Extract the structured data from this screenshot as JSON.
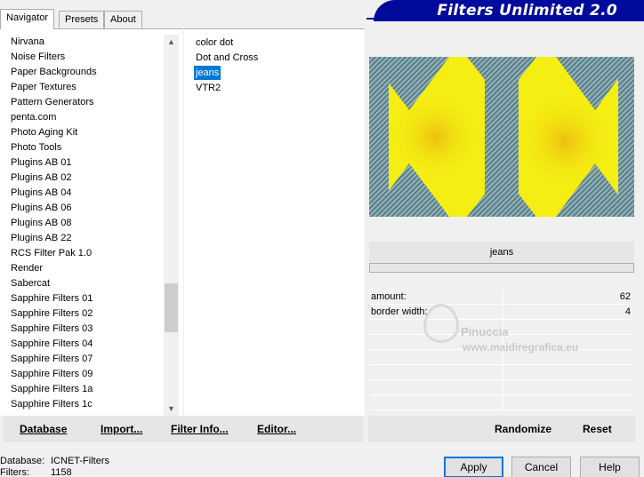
{
  "tabs": [
    {
      "label": "Navigator",
      "active": true
    },
    {
      "label": "Presets",
      "active": false
    },
    {
      "label": "About",
      "active": false
    }
  ],
  "banner": {
    "title": "Filters Unlimited 2.0"
  },
  "categories": [
    "Nirvana",
    "Noise Filters",
    "Paper Backgrounds",
    "Paper Textures",
    "Pattern Generators",
    "penta.com",
    "Photo Aging Kit",
    "Photo Tools",
    "Plugins AB 01",
    "Plugins AB 02",
    "Plugins AB 04",
    "Plugins AB 06",
    "Plugins AB 08",
    "Plugins AB 22",
    "RCS Filter Pak 1.0",
    "Render",
    "Sabercat",
    "Sapphire Filters 01",
    "Sapphire Filters 02",
    "Sapphire Filters 03",
    "Sapphire Filters 04",
    "Sapphire Filters 07",
    "Sapphire Filters 09",
    "Sapphire Filters 1a",
    "Sapphire Filters 1c"
  ],
  "filters": [
    {
      "label": "color dot",
      "selected": false
    },
    {
      "label": "Dot and Cross",
      "selected": false
    },
    {
      "label": "jeans",
      "selected": true
    },
    {
      "label": "VTR2",
      "selected": false
    }
  ],
  "preview": {
    "filter_name": "jeans"
  },
  "params": [
    {
      "label": "amount:",
      "value": "62"
    },
    {
      "label": "border width:",
      "value": "4"
    },
    {
      "label": "",
      "value": ""
    },
    {
      "label": "",
      "value": ""
    },
    {
      "label": "",
      "value": ""
    },
    {
      "label": "",
      "value": ""
    },
    {
      "label": "",
      "value": ""
    },
    {
      "label": "",
      "value": ""
    }
  ],
  "watermark": {
    "line1": "Pinuccia",
    "line2": "www.maidiregrafica.eu"
  },
  "left_buttons": {
    "database": "Database",
    "import": "Import...",
    "filter_info": "Filter Info...",
    "editor": "Editor..."
  },
  "right_buttons": {
    "randomize": "Randomize",
    "reset": "Reset"
  },
  "info": {
    "database_label": "Database:",
    "database_value": "ICNET-Filters",
    "filters_label": "Filters:",
    "filters_value": "1158"
  },
  "dialog_buttons": {
    "apply": "Apply",
    "cancel": "Cancel",
    "help": "Help"
  },
  "colors": {
    "accent": "#0078d7",
    "banner": "#000a9c",
    "preview_yellow": "#f4ee12",
    "preview_blue": "#4f7d9c",
    "preview_orange": "#e9a00e"
  }
}
